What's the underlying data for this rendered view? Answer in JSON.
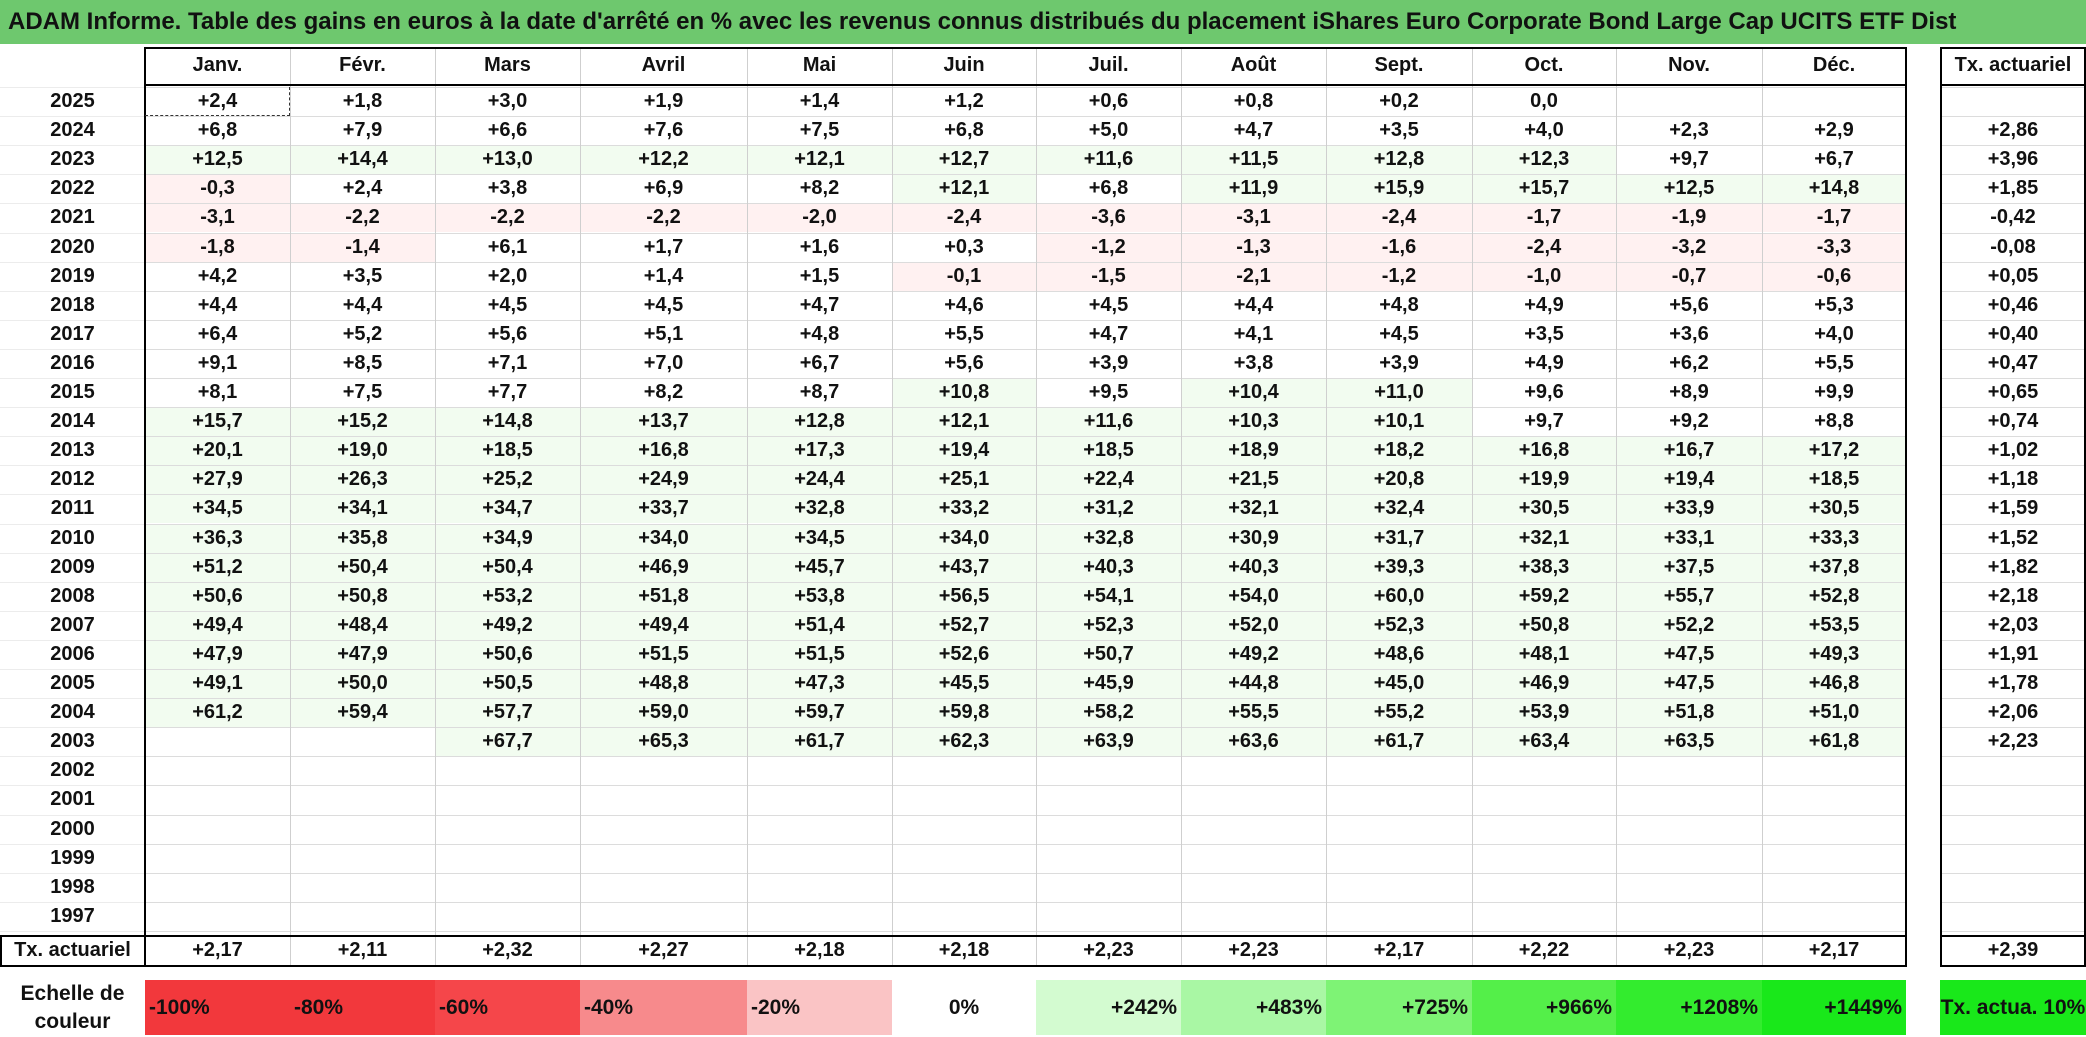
{
  "title": "ADAM Informe. Table des gains en euros à la date d'arrêté en % avec les revenus connus distribués du placement iShares Euro Corporate Bond Large Cap UCITS ETF Dist",
  "months": [
    "Janv.",
    "Févr.",
    "Mars",
    "Avril",
    "Mai",
    "Juin",
    "Juil.",
    "Août",
    "Sept.",
    "Oct.",
    "Nov.",
    "Déc."
  ],
  "tx_header": "Tx. actuariel",
  "rows": [
    {
      "year": "2025",
      "values": [
        "+2,4",
        "+1,8",
        "+3,0",
        "+1,9",
        "+1,4",
        "+1,2",
        "+0,6",
        "+0,8",
        "+0,2",
        "0,0",
        "",
        ""
      ],
      "tx": ""
    },
    {
      "year": "2024",
      "values": [
        "+6,8",
        "+7,9",
        "+6,6",
        "+7,6",
        "+7,5",
        "+6,8",
        "+5,0",
        "+4,7",
        "+3,5",
        "+4,0",
        "+2,3",
        "+2,9"
      ],
      "tx": "+2,86"
    },
    {
      "year": "2023",
      "values": [
        "+12,5",
        "+14,4",
        "+13,0",
        "+12,2",
        "+12,1",
        "+12,7",
        "+11,6",
        "+11,5",
        "+12,8",
        "+12,3",
        "+9,7",
        "+6,7"
      ],
      "tx": "+3,96"
    },
    {
      "year": "2022",
      "values": [
        "-0,3",
        "+2,4",
        "+3,8",
        "+6,9",
        "+8,2",
        "+12,1",
        "+6,8",
        "+11,9",
        "+15,9",
        "+15,7",
        "+12,5",
        "+14,8"
      ],
      "tx": "+1,85"
    },
    {
      "year": "2021",
      "values": [
        "-3,1",
        "-2,2",
        "-2,2",
        "-2,2",
        "-2,0",
        "-2,4",
        "-3,6",
        "-3,1",
        "-2,4",
        "-1,7",
        "-1,9",
        "-1,7"
      ],
      "tx": "-0,42"
    },
    {
      "year": "2020",
      "values": [
        "-1,8",
        "-1,4",
        "+6,1",
        "+1,7",
        "+1,6",
        "+0,3",
        "-1,2",
        "-1,3",
        "-1,6",
        "-2,4",
        "-3,2",
        "-3,3"
      ],
      "tx": "-0,08"
    },
    {
      "year": "2019",
      "values": [
        "+4,2",
        "+3,5",
        "+2,0",
        "+1,4",
        "+1,5",
        "-0,1",
        "-1,5",
        "-2,1",
        "-1,2",
        "-1,0",
        "-0,7",
        "-0,6"
      ],
      "tx": "+0,05"
    },
    {
      "year": "2018",
      "values": [
        "+4,4",
        "+4,4",
        "+4,5",
        "+4,5",
        "+4,7",
        "+4,6",
        "+4,5",
        "+4,4",
        "+4,8",
        "+4,9",
        "+5,6",
        "+5,3"
      ],
      "tx": "+0,46"
    },
    {
      "year": "2017",
      "values": [
        "+6,4",
        "+5,2",
        "+5,6",
        "+5,1",
        "+4,8",
        "+5,5",
        "+4,7",
        "+4,1",
        "+4,5",
        "+3,5",
        "+3,6",
        "+4,0"
      ],
      "tx": "+0,40"
    },
    {
      "year": "2016",
      "values": [
        "+9,1",
        "+8,5",
        "+7,1",
        "+7,0",
        "+6,7",
        "+5,6",
        "+3,9",
        "+3,8",
        "+3,9",
        "+4,9",
        "+6,2",
        "+5,5"
      ],
      "tx": "+0,47"
    },
    {
      "year": "2015",
      "values": [
        "+8,1",
        "+7,5",
        "+7,7",
        "+8,2",
        "+8,7",
        "+10,8",
        "+9,5",
        "+10,4",
        "+11,0",
        "+9,6",
        "+8,9",
        "+9,9"
      ],
      "tx": "+0,65"
    },
    {
      "year": "2014",
      "values": [
        "+15,7",
        "+15,2",
        "+14,8",
        "+13,7",
        "+12,8",
        "+12,1",
        "+11,6",
        "+10,3",
        "+10,1",
        "+9,7",
        "+9,2",
        "+8,8"
      ],
      "tx": "+0,74"
    },
    {
      "year": "2013",
      "values": [
        "+20,1",
        "+19,0",
        "+18,5",
        "+16,8",
        "+17,3",
        "+19,4",
        "+18,5",
        "+18,9",
        "+18,2",
        "+16,8",
        "+16,7",
        "+17,2"
      ],
      "tx": "+1,02"
    },
    {
      "year": "2012",
      "values": [
        "+27,9",
        "+26,3",
        "+25,2",
        "+24,9",
        "+24,4",
        "+25,1",
        "+22,4",
        "+21,5",
        "+20,8",
        "+19,9",
        "+19,4",
        "+18,5"
      ],
      "tx": "+1,18"
    },
    {
      "year": "2011",
      "values": [
        "+34,5",
        "+34,1",
        "+34,7",
        "+33,7",
        "+32,8",
        "+33,2",
        "+31,2",
        "+32,1",
        "+32,4",
        "+30,5",
        "+33,9",
        "+30,5"
      ],
      "tx": "+1,59"
    },
    {
      "year": "2010",
      "values": [
        "+36,3",
        "+35,8",
        "+34,9",
        "+34,0",
        "+34,5",
        "+34,0",
        "+32,8",
        "+30,9",
        "+31,7",
        "+32,1",
        "+33,1",
        "+33,3"
      ],
      "tx": "+1,52"
    },
    {
      "year": "2009",
      "values": [
        "+51,2",
        "+50,4",
        "+50,4",
        "+46,9",
        "+45,7",
        "+43,7",
        "+40,3",
        "+40,3",
        "+39,3",
        "+38,3",
        "+37,5",
        "+37,8"
      ],
      "tx": "+1,82"
    },
    {
      "year": "2008",
      "values": [
        "+50,6",
        "+50,8",
        "+53,2",
        "+51,8",
        "+53,8",
        "+56,5",
        "+54,1",
        "+54,0",
        "+60,0",
        "+59,2",
        "+55,7",
        "+52,8"
      ],
      "tx": "+2,18"
    },
    {
      "year": "2007",
      "values": [
        "+49,4",
        "+48,4",
        "+49,2",
        "+49,4",
        "+51,4",
        "+52,7",
        "+52,3",
        "+52,0",
        "+52,3",
        "+50,8",
        "+52,2",
        "+53,5"
      ],
      "tx": "+2,03"
    },
    {
      "year": "2006",
      "values": [
        "+47,9",
        "+47,9",
        "+50,6",
        "+51,5",
        "+51,5",
        "+52,6",
        "+50,7",
        "+49,2",
        "+48,6",
        "+48,1",
        "+47,5",
        "+49,3"
      ],
      "tx": "+1,91"
    },
    {
      "year": "2005",
      "values": [
        "+49,1",
        "+50,0",
        "+50,5",
        "+48,8",
        "+47,3",
        "+45,5",
        "+45,9",
        "+44,8",
        "+45,0",
        "+46,9",
        "+47,5",
        "+46,8"
      ],
      "tx": "+1,78"
    },
    {
      "year": "2004",
      "values": [
        "+61,2",
        "+59,4",
        "+57,7",
        "+59,0",
        "+59,7",
        "+59,8",
        "+58,2",
        "+55,5",
        "+55,2",
        "+53,9",
        "+51,8",
        "+51,0"
      ],
      "tx": "+2,06"
    },
    {
      "year": "2003",
      "values": [
        "",
        "",
        "+67,7",
        "+65,3",
        "+61,7",
        "+62,3",
        "+63,9",
        "+63,6",
        "+61,7",
        "+63,4",
        "+63,5",
        "+61,8"
      ],
      "tx": "+2,23"
    },
    {
      "year": "2002",
      "values": [
        "",
        "",
        "",
        "",
        "",
        "",
        "",
        "",
        "",
        "",
        "",
        ""
      ],
      "tx": ""
    },
    {
      "year": "2001",
      "values": [
        "",
        "",
        "",
        "",
        "",
        "",
        "",
        "",
        "",
        "",
        "",
        ""
      ],
      "tx": ""
    },
    {
      "year": "2000",
      "values": [
        "",
        "",
        "",
        "",
        "",
        "",
        "",
        "",
        "",
        "",
        "",
        ""
      ],
      "tx": ""
    },
    {
      "year": "1999",
      "values": [
        "",
        "",
        "",
        "",
        "",
        "",
        "",
        "",
        "",
        "",
        "",
        ""
      ],
      "tx": ""
    },
    {
      "year": "1998",
      "values": [
        "",
        "",
        "",
        "",
        "",
        "",
        "",
        "",
        "",
        "",
        "",
        ""
      ],
      "tx": ""
    },
    {
      "year": "1997",
      "values": [
        "",
        "",
        "",
        "",
        "",
        "",
        "",
        "",
        "",
        "",
        "",
        ""
      ],
      "tx": ""
    }
  ],
  "footer": {
    "label": "Tx. actuariel",
    "values": [
      "+2,17",
      "+2,11",
      "+2,32",
      "+2,27",
      "+2,18",
      "+2,18",
      "+2,23",
      "+2,23",
      "+2,17",
      "+2,22",
      "+2,23",
      "+2,17"
    ],
    "total": "+2,39"
  },
  "legend": {
    "label": "Echelle de couleur",
    "items": [
      {
        "text": "-100%",
        "color": "#f2383c",
        "align": "left"
      },
      {
        "text": "-80%",
        "color": "#f2383c",
        "align": "left"
      },
      {
        "text": "-60%",
        "color": "#f5464a",
        "align": "left"
      },
      {
        "text": "-40%",
        "color": "#f78a8c",
        "align": "left"
      },
      {
        "text": "-20%",
        "color": "#fac4c5",
        "align": "left"
      },
      {
        "text": "0%",
        "color": "#ffffff",
        "align": "center"
      },
      {
        "text": "+242%",
        "color": "#d3fbd0",
        "align": "right"
      },
      {
        "text": "+483%",
        "color": "#a9f7a4",
        "align": "right"
      },
      {
        "text": "+725%",
        "color": "#7ef375",
        "align": "right"
      },
      {
        "text": "+966%",
        "color": "#54ef49",
        "align": "right"
      },
      {
        "text": "+1208%",
        "color": "#33ec2e",
        "align": "right"
      },
      {
        "text": "+1449%",
        "color": "#19e81a",
        "align": "right"
      }
    ],
    "total_text": "Tx. actua. 10%",
    "total_color": "#19e81a"
  },
  "colors": {
    "title_bg": "#6ec86e",
    "negative_tint": "#fff1f1",
    "positive_tint": "#f2fcf0"
  }
}
